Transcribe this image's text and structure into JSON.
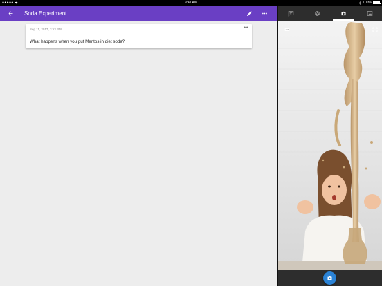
{
  "status_bar": {
    "signal": "●●●●● ",
    "time": "9:41 AM",
    "battery_text": "100%",
    "battery_level": 1.0
  },
  "app_bar": {
    "title": "Soda Experiment",
    "back_icon": "arrow-left-icon",
    "edit_icon": "pencil-icon",
    "more_icon": "more-horizontal-icon",
    "color": "#6a3fc4"
  },
  "note_card": {
    "date": "Sep 11, 2017, 3:53 PM",
    "more_label": "•••",
    "text": "What happens when you put Mentos in diet soda?"
  },
  "side_panel": {
    "tabs": [
      {
        "icon": "note-icon",
        "active": false
      },
      {
        "icon": "sensor-icon",
        "active": false
      },
      {
        "icon": "camera-icon",
        "active": true
      },
      {
        "icon": "gallery-icon",
        "active": false
      }
    ],
    "capture_icon": "camera-icon",
    "capture_color": "#2b83d6",
    "background": "#2d2d2d"
  }
}
